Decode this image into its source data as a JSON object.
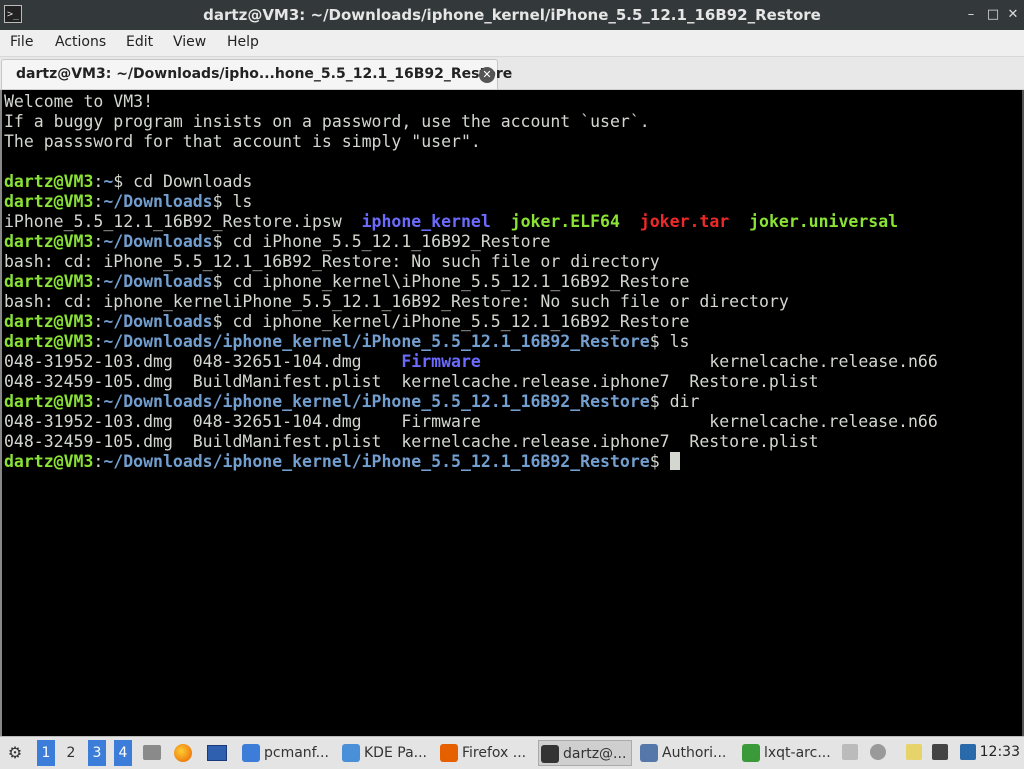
{
  "window": {
    "title": "dartz@VM3: ~/Downloads/iphone_kernel/iPhone_5.5_12.1_16B92_Restore",
    "app_icon": "terminal-icon",
    "buttons": {
      "minimize": "–",
      "maximize": "□",
      "close": "✕"
    }
  },
  "menubar": {
    "items": [
      "File",
      "Actions",
      "Edit",
      "View",
      "Help"
    ]
  },
  "tab": {
    "label": "dartz@VM3: ~/Downloads/ipho...hone_5.5_12.1_16B92_Restore",
    "close": "✕"
  },
  "terminal": {
    "colors": {
      "user": "#8ae234",
      "path": "#729fcf",
      "dir": "#6b6bff",
      "archive": "#ef2929",
      "text": "#d3d7cf"
    },
    "lines": [
      [
        {
          "t": "Welcome to VM3!",
          "c": "w"
        }
      ],
      [
        {
          "t": "If a buggy program insists on a password, use the account `user`.",
          "c": "w"
        }
      ],
      [
        {
          "t": "The passsword for that account is simply \"user\".",
          "c": "w"
        }
      ],
      [],
      [
        {
          "t": "dartz@VM3",
          "c": "g"
        },
        {
          "t": ":",
          "c": "w"
        },
        {
          "t": "~",
          "c": "b"
        },
        {
          "t": "$ cd Downloads",
          "c": "w"
        }
      ],
      [
        {
          "t": "dartz@VM3",
          "c": "g"
        },
        {
          "t": ":",
          "c": "w"
        },
        {
          "t": "~/Downloads",
          "c": "b"
        },
        {
          "t": "$ ls",
          "c": "w"
        }
      ],
      [
        {
          "t": "iPhone_5.5_12.1_16B92_Restore.ipsw  ",
          "c": "w"
        },
        {
          "t": "iphone_kernel",
          "c": "bv"
        },
        {
          "t": "  ",
          "c": "w"
        },
        {
          "t": "joker.ELF64",
          "c": "g"
        },
        {
          "t": "  ",
          "c": "w"
        },
        {
          "t": "joker.tar",
          "c": "r"
        },
        {
          "t": "  ",
          "c": "w"
        },
        {
          "t": "joker.universal",
          "c": "g"
        }
      ],
      [
        {
          "t": "dartz@VM3",
          "c": "g"
        },
        {
          "t": ":",
          "c": "w"
        },
        {
          "t": "~/Downloads",
          "c": "b"
        },
        {
          "t": "$ cd iPhone_5.5_12.1_16B92_Restore",
          "c": "w"
        }
      ],
      [
        {
          "t": "bash: cd: iPhone_5.5_12.1_16B92_Restore: No such file or directory",
          "c": "w"
        }
      ],
      [
        {
          "t": "dartz@VM3",
          "c": "g"
        },
        {
          "t": ":",
          "c": "w"
        },
        {
          "t": "~/Downloads",
          "c": "b"
        },
        {
          "t": "$ cd iphone_kernel\\iPhone_5.5_12.1_16B92_Restore",
          "c": "w"
        }
      ],
      [
        {
          "t": "bash: cd: iphone_kerneliPhone_5.5_12.1_16B92_Restore: No such file or directory",
          "c": "w"
        }
      ],
      [
        {
          "t": "dartz@VM3",
          "c": "g"
        },
        {
          "t": ":",
          "c": "w"
        },
        {
          "t": "~/Downloads",
          "c": "b"
        },
        {
          "t": "$ cd iphone_kernel/iPhone_5.5_12.1_16B92_Restore",
          "c": "w"
        }
      ],
      [
        {
          "t": "dartz@VM3",
          "c": "g"
        },
        {
          "t": ":",
          "c": "w"
        },
        {
          "t": "~/Downloads/iphone_kernel/iPhone_5.5_12.1_16B92_Restore",
          "c": "b"
        },
        {
          "t": "$ ls",
          "c": "w"
        }
      ],
      [
        {
          "t": "048-31952-103.dmg  048-32651-104.dmg    ",
          "c": "w"
        },
        {
          "t": "Firmware",
          "c": "bv"
        },
        {
          "t": "                       kernelcache.release.n66",
          "c": "w"
        }
      ],
      [
        {
          "t": "048-32459-105.dmg  BuildManifest.plist  kernelcache.release.iphone7  Restore.plist",
          "c": "w"
        }
      ],
      [
        {
          "t": "dartz@VM3",
          "c": "g"
        },
        {
          "t": ":",
          "c": "w"
        },
        {
          "t": "~/Downloads/iphone_kernel/iPhone_5.5_12.1_16B92_Restore",
          "c": "b"
        },
        {
          "t": "$ dir",
          "c": "w"
        }
      ],
      [
        {
          "t": "048-31952-103.dmg  048-32651-104.dmg    Firmware                       kernelcache.release.n66",
          "c": "w"
        }
      ],
      [
        {
          "t": "048-32459-105.dmg  BuildManifest.plist  kernelcache.release.iphone7  Restore.plist",
          "c": "w"
        }
      ],
      [
        {
          "t": "dartz@VM3",
          "c": "g"
        },
        {
          "t": ":",
          "c": "w"
        },
        {
          "t": "~/Downloads/iphone_kernel/iPhone_5.5_12.1_16B92_Restore",
          "c": "b"
        },
        {
          "t": "$ ",
          "c": "w"
        },
        {
          "cursor": true
        }
      ]
    ]
  },
  "taskbar": {
    "start_icon": "lxqt-menu-icon",
    "desktops": [
      "1",
      "2",
      "3",
      "4"
    ],
    "active_desktops": [
      "1",
      "3",
      "4"
    ],
    "quicklaunch": [
      "file-manager-icon",
      "firefox-icon",
      "desktop-icon"
    ],
    "tasks": [
      {
        "label": "pcmanf...",
        "icon": "folder-icon",
        "color": "#3b7dd8"
      },
      {
        "label": "KDE Pa...",
        "icon": "kde-icon",
        "color": "#4a90d9"
      },
      {
        "label": "Firefox ...",
        "icon": "firefox-icon",
        "color": "#e66000"
      },
      {
        "label": "dartz@...",
        "icon": "terminal-icon",
        "color": "#333333",
        "active": true
      },
      {
        "label": "Authori...",
        "icon": "key-icon",
        "color": "#5577aa"
      },
      {
        "label": "lxqt-arc...",
        "icon": "archive-icon",
        "color": "#3a9a3a"
      }
    ],
    "tray": [
      "scroll-indicator-icon",
      "volume-icon",
      "clipboard-icon",
      "network-icon",
      "chat-icon"
    ],
    "clock": "12:33"
  }
}
